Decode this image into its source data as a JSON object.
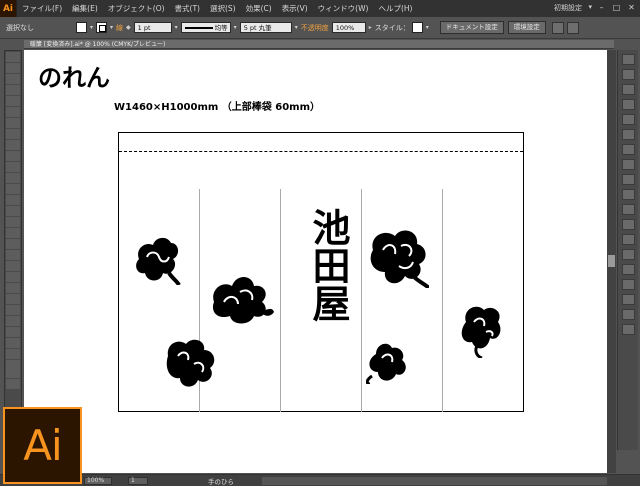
{
  "menubar": {
    "app_logo": "Ai",
    "items": [
      "ファイル(F)",
      "編集(E)",
      "オブジェクト(O)",
      "書式(T)",
      "選択(S)",
      "効果(C)",
      "表示(V)",
      "ウィンドウ(W)",
      "ヘルプ(H)"
    ],
    "workspace": "初期設定"
  },
  "controlbar": {
    "selection": "選択なし",
    "stroke_label": "線",
    "stroke_weight": "1 pt",
    "stroke_profile": "均等",
    "brush": "5 pt 丸筆",
    "opacity_label": "不透明度",
    "opacity_value": "100%",
    "style_label": "スタイル：",
    "doc_setup_button": "ドキュメント設定",
    "prefs_button": "環境設定"
  },
  "doc_tab": {
    "label": "暖簾 [変換済み].ai* @ 100% (CMYK/プレビュー)"
  },
  "artboard": {
    "title": "のれん",
    "dimensions": "W1460×H1000mm （上部棒袋 60mm）",
    "brand_name": "池田屋"
  },
  "statusbar": {
    "zoom": "100%",
    "page": "1",
    "tool_label": "手のひら"
  },
  "logo": {
    "text": "Ai",
    "accent_color": "#f7931e",
    "bg_color": "#2b1500"
  }
}
